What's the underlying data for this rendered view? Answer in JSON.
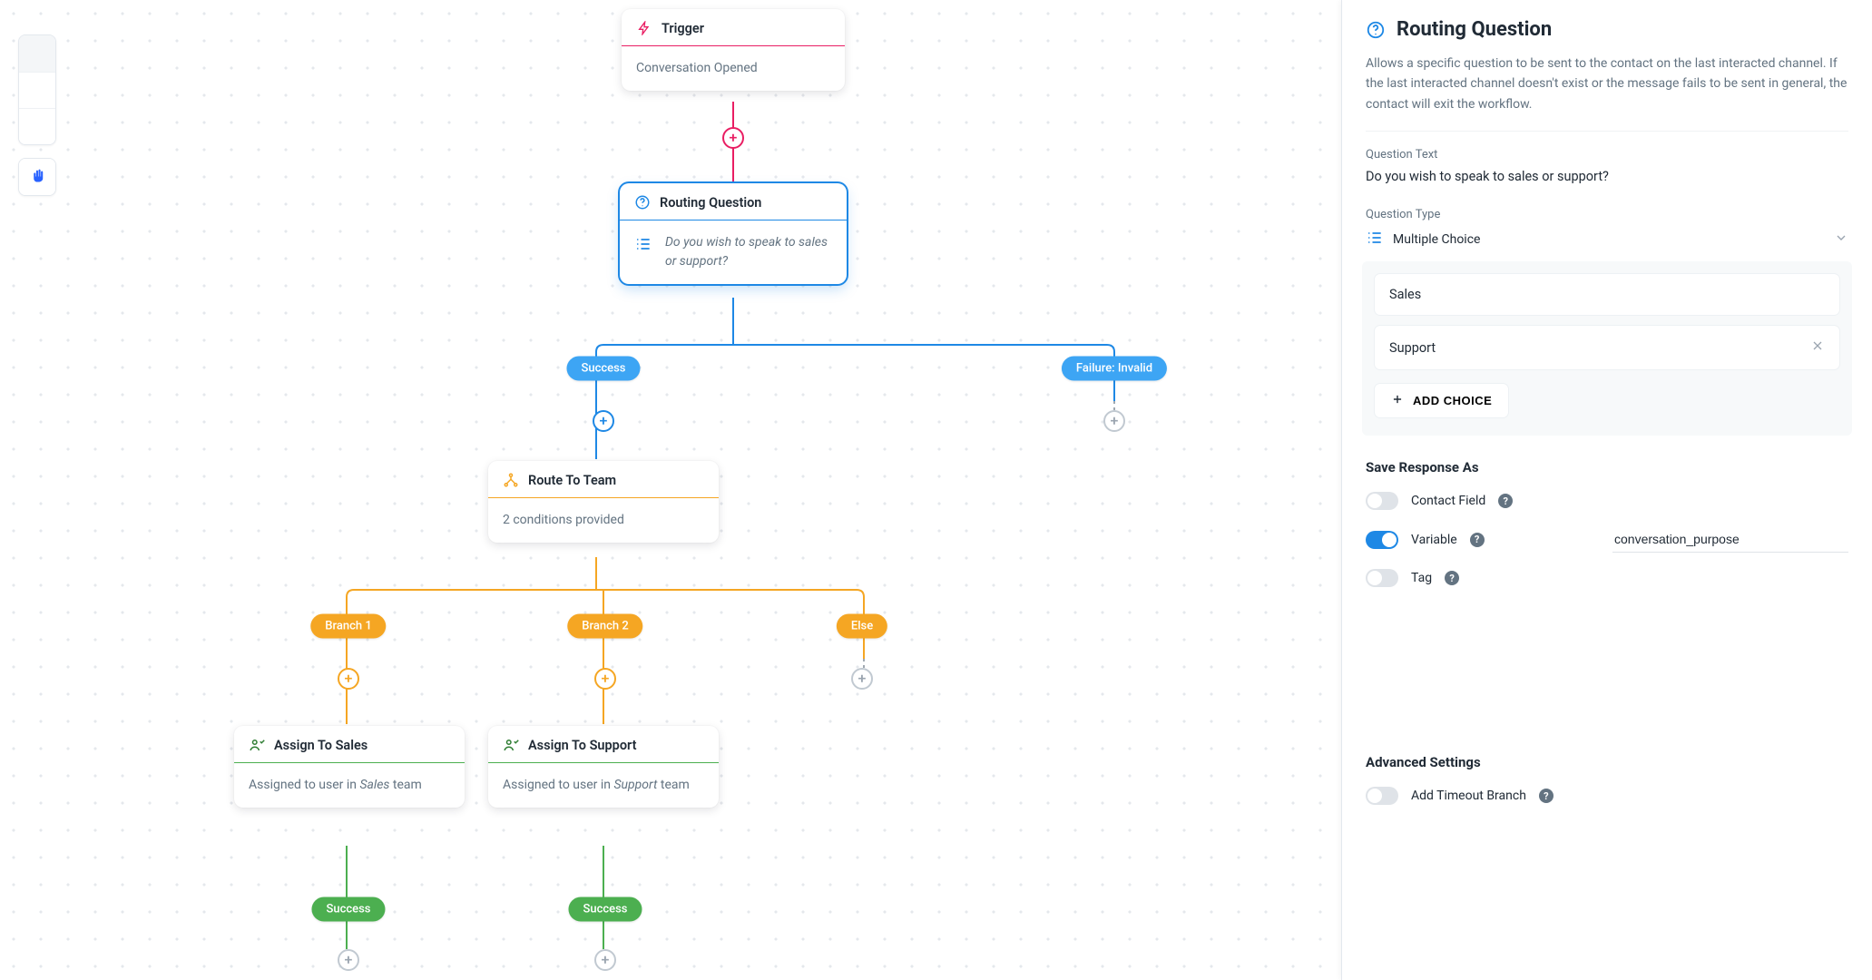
{
  "canvas": {
    "toolbar": {
      "zoom_in_icon": "plus",
      "zoom_out_icon": "minus",
      "locate_icon": "crosshair",
      "pan_icon": "hand"
    },
    "nodes": {
      "trigger": {
        "title": "Trigger",
        "body": "Conversation Opened",
        "accent": "#e91e63"
      },
      "routing_question": {
        "title": "Routing Question",
        "body": "Do you wish to speak to sales or support?",
        "accent": "#1e88e5",
        "selected": true,
        "outgoing_labels": {
          "success": "Success",
          "failure": "Failure: Invalid"
        }
      },
      "route_to_team": {
        "title": "Route To Team",
        "body": "2 conditions provided",
        "accent": "#f5a623",
        "outgoing_labels": {
          "branch1": "Branch 1",
          "branch2": "Branch 2",
          "else": "Else"
        }
      },
      "assign_sales": {
        "title": "Assign To Sales",
        "body_prefix": "Assigned to user in ",
        "body_team": "Sales",
        "body_suffix": " team",
        "accent": "#4caf50",
        "outgoing_label": "Success"
      },
      "assign_support": {
        "title": "Assign To Support",
        "body_prefix": "Assigned to user in ",
        "body_team": "Support",
        "body_suffix": " team",
        "accent": "#4caf50",
        "outgoing_label": "Success"
      }
    }
  },
  "panel": {
    "collapse_icon": "chevron-right",
    "title": "Routing Question",
    "description": "Allows a specific question to be sent to the contact on the last interacted channel. If the last interacted channel doesn't exist or the message fails to be sent in general, the contact will exit the workflow.",
    "question_text": {
      "label": "Question Text",
      "value": "Do you wish to speak to sales or support?"
    },
    "question_type": {
      "label": "Question Type",
      "value": "Multiple Choice",
      "icon": "list"
    },
    "choices": [
      {
        "label": "Sales",
        "removable": false
      },
      {
        "label": "Support",
        "removable": true
      }
    ],
    "add_choice_label": "ADD CHOICE",
    "save_response": {
      "label": "Save Response As",
      "options": {
        "contact_field": {
          "label": "Contact Field",
          "enabled": false
        },
        "variable": {
          "label": "Variable",
          "enabled": true,
          "value": "conversation_purpose"
        },
        "tag": {
          "label": "Tag",
          "enabled": false
        }
      }
    },
    "advanced": {
      "label": "Advanced Settings",
      "timeout_branch": {
        "label": "Add Timeout Branch",
        "enabled": false
      }
    }
  }
}
